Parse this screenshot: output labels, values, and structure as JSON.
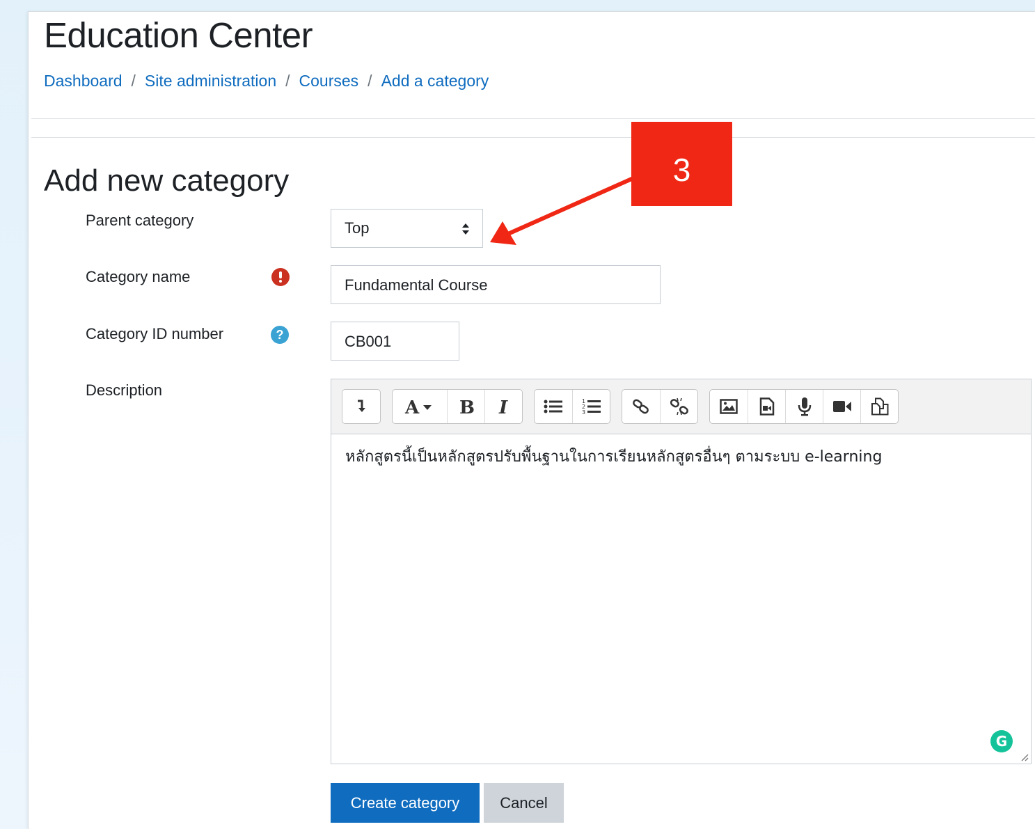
{
  "site": {
    "title": "Education Center"
  },
  "breadcrumb": {
    "items": [
      "Dashboard",
      "Site administration",
      "Courses",
      "Add a category"
    ],
    "separator": "/"
  },
  "form": {
    "heading": "Add new category",
    "parent_category": {
      "label": "Parent category",
      "value": "Top"
    },
    "category_name": {
      "label": "Category name",
      "value": "Fundamental Course",
      "required_icon": "exclamation-circle-icon"
    },
    "category_id": {
      "label": "Category ID number",
      "value": "CB001",
      "help_icon": "question-circle-icon",
      "help_glyph": "?"
    },
    "description": {
      "label": "Description",
      "text": "หลักสูตรนี้เป็นหลักสูตรปรับพื้นฐานในการเรียนหลักสูตรอื่นๆ ตามระบบ e-learning",
      "toolbar": [
        [
          "collapse-icon"
        ],
        [
          "font-style-icon",
          "bold-icon",
          "italic-icon"
        ],
        [
          "unordered-list-icon",
          "ordered-list-icon"
        ],
        [
          "link-icon",
          "unlink-icon"
        ],
        [
          "image-icon",
          "media-icon",
          "record-audio-icon",
          "record-video-icon",
          "manage-files-icon"
        ]
      ]
    },
    "buttons": {
      "submit": "Create category",
      "cancel": "Cancel"
    }
  },
  "annotation": {
    "number": "3",
    "color": "#ef2714"
  },
  "colors": {
    "link": "#0f6cbf",
    "primary": "#0f6cbf",
    "required": "#ca3120",
    "help": "#3ba3d3",
    "grammarly": "#15c39a"
  }
}
